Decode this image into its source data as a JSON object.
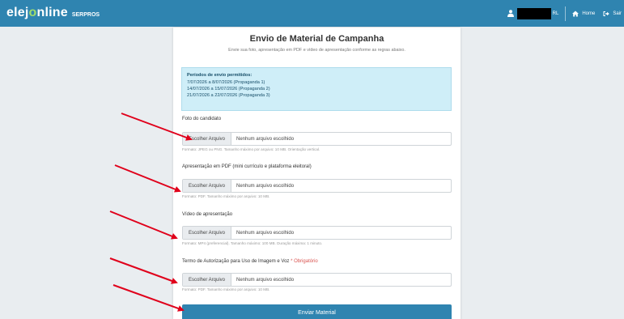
{
  "navbar": {
    "brand_part1": "elej",
    "brand_o": "o",
    "brand_part2": "nline",
    "brand_sub": "SERPROS",
    "user_suffix": "RL",
    "home_label": "Home",
    "logout_label": "Sair"
  },
  "page": {
    "title": "Envio de Material de Campanha",
    "subtitle": "Envie sua foto, apresentação em PDF e vídeo de apresentação conforme as regras abaixo."
  },
  "info_box": {
    "heading": "Períodos de envio permitidos:",
    "periods": [
      "7/07/2026 a 8/07/2026 (Propaganda 1)",
      "14/07/2026 a 15/07/2026 (Propaganda 2)",
      "21/07/2026 a 22/07/2026 (Propaganda 3)"
    ]
  },
  "fields": [
    {
      "label": "Foto do candidato",
      "required_text": "",
      "button": "Escolher Arquivo",
      "value": "Nenhum arquivo escolhido",
      "help": "Formato: JPEG ou PNG. Tamanho máximo por arquivo: 10 MB. Orientação vertical."
    },
    {
      "label": "Apresentação em PDF (mini currículo e plataforma eleitoral)",
      "required_text": "",
      "button": "Escolher Arquivo",
      "value": "Nenhum arquivo escolhido",
      "help": "Formato: PDF. Tamanho máximo por arquivo: 10 MB."
    },
    {
      "label": "Vídeo de apresentação",
      "required_text": "",
      "button": "Escolher Arquivo",
      "value": "Nenhum arquivo escolhido",
      "help": "Formato: MP4 (preferencial). Tamanho máximo: 100 MB. Duração máxima: 1 minuto."
    },
    {
      "label": "Termo de Autorização para Uso de Imagem e Voz",
      "required_text": "* Obrigatório",
      "button": "Escolher Arquivo",
      "value": "Nenhum arquivo escolhido",
      "help": "Formato: PDF. Tamanho máximo por arquivo: 10 MB."
    }
  ],
  "submit_label": "Enviar Material",
  "colors": {
    "navbar": "#2f84b0",
    "brand_accent": "#9fdc6c",
    "info_bg": "#cfeef8",
    "required": "#d9534f",
    "arrow": "#e0001b"
  }
}
